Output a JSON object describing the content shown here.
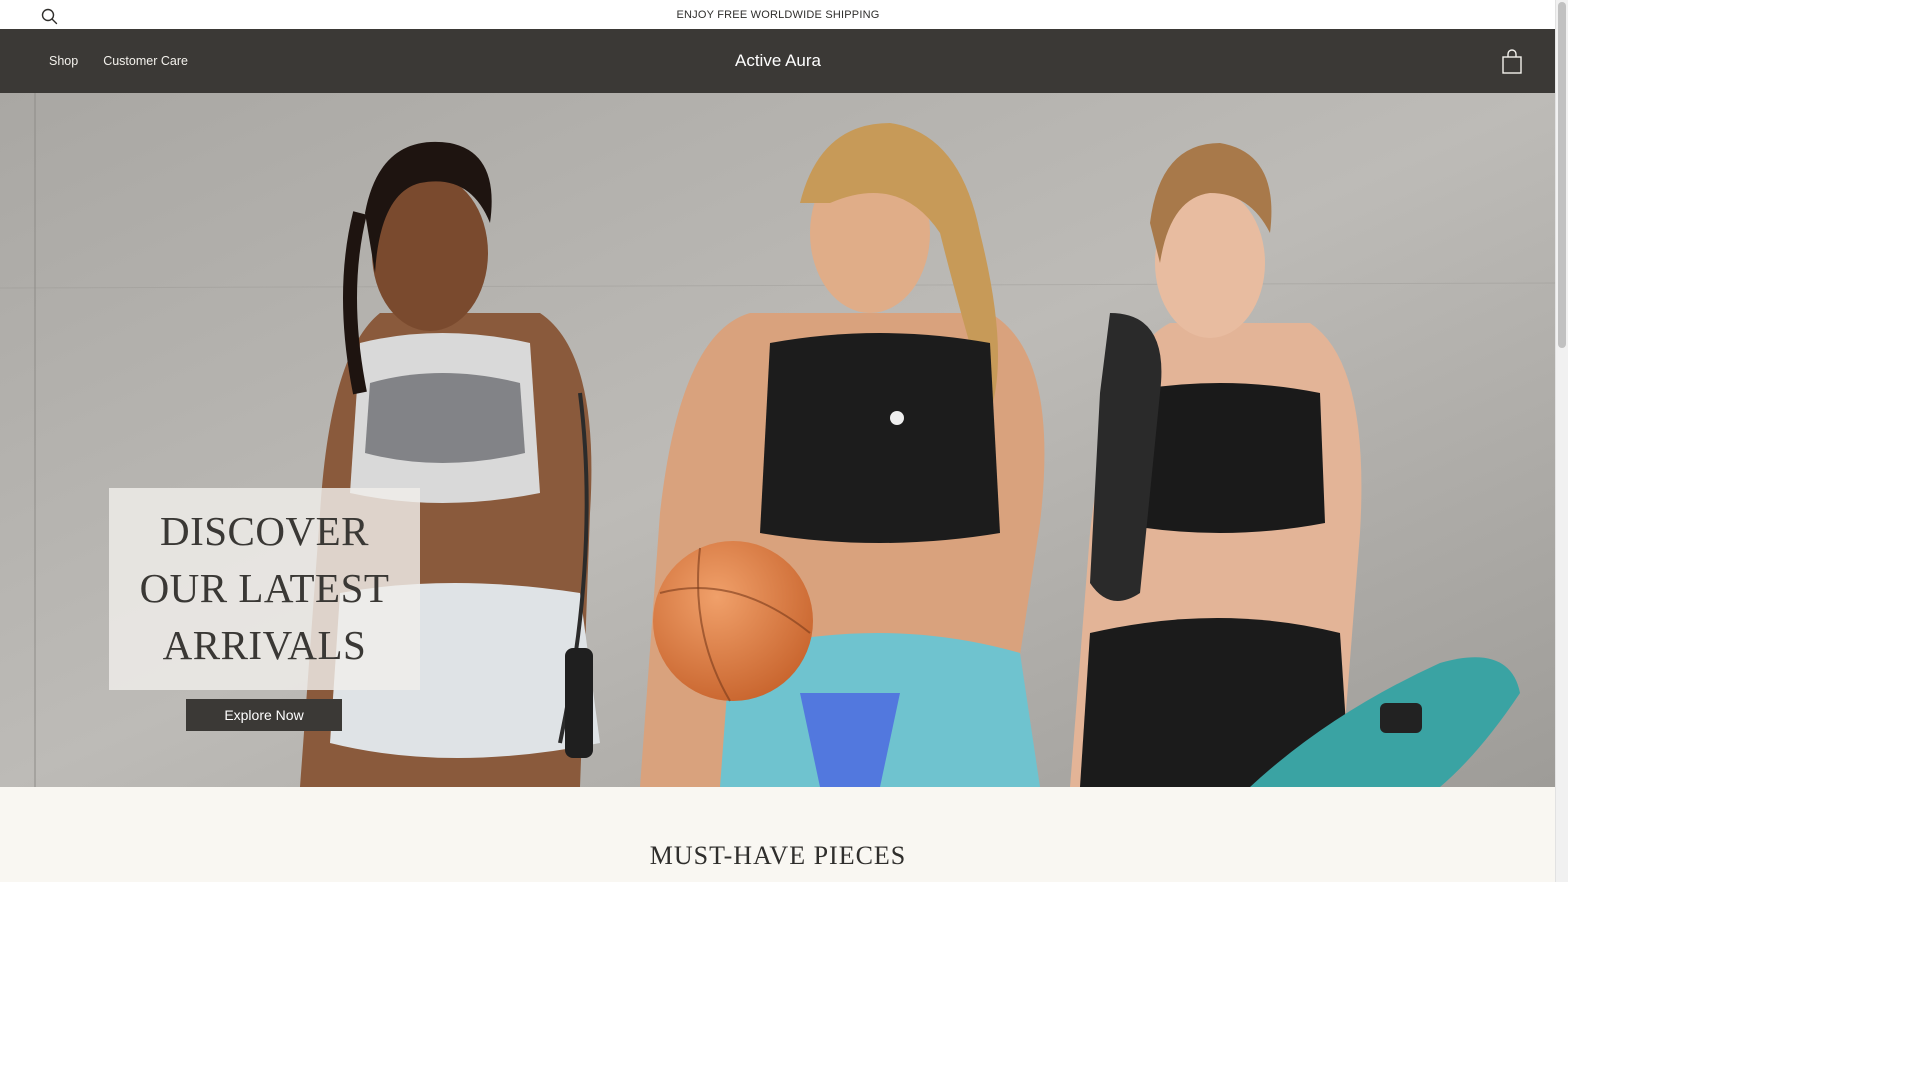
{
  "announcement": {
    "text": "ENJOY FREE WORLDWIDE SHIPPING",
    "search_icon": "search-icon"
  },
  "header": {
    "nav": [
      {
        "label": "Shop"
      },
      {
        "label": "Customer Care"
      }
    ],
    "brand": "Active Aura",
    "cart_icon": "shopping-bag-icon"
  },
  "hero": {
    "title_lines": [
      "DISCOVER",
      "OUR LATEST",
      "ARRIVALS"
    ],
    "cta_label": "Explore Now",
    "image_subject": "hero-photo"
  },
  "section": {
    "title": "MUST-HAVE PIECES"
  },
  "colors": {
    "header_bg": "#3b3936",
    "announcement_bg": "#ffffff",
    "section_bg": "#f9f7f2",
    "cta_bg": "#3b3936",
    "text_dark": "#2f2e2c"
  }
}
